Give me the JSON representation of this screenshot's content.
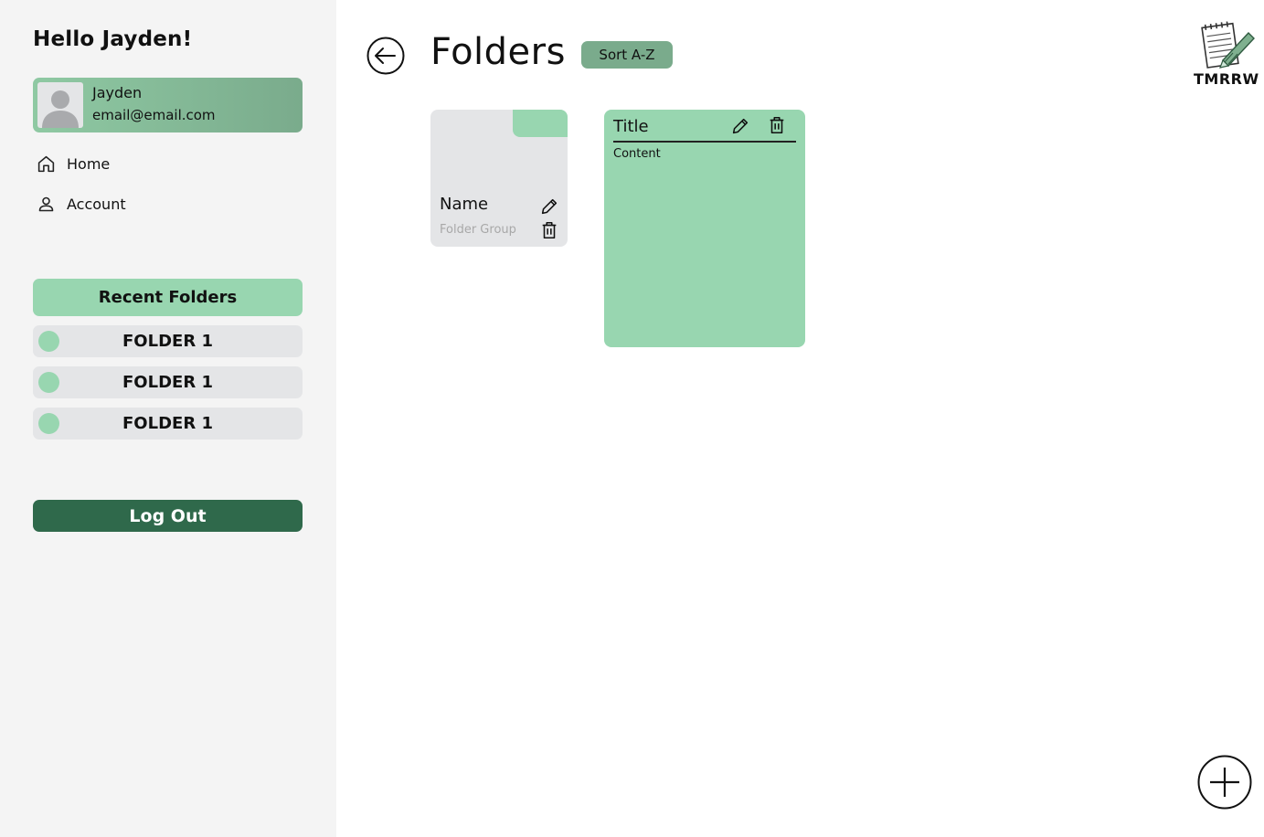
{
  "sidebar": {
    "greeting": "Hello Jayden!",
    "user": {
      "name": "Jayden",
      "email": "email@email.com"
    },
    "nav": [
      {
        "label": "Home",
        "icon": "home-icon"
      },
      {
        "label": "Account",
        "icon": "user-icon"
      }
    ],
    "recent_header": "Recent Folders",
    "recent_folders": [
      {
        "label": "FOLDER 1"
      },
      {
        "label": "FOLDER 1"
      },
      {
        "label": "FOLDER 1"
      }
    ],
    "logout_label": "Log Out"
  },
  "header": {
    "title": "Folders",
    "sort_label": "Sort A-Z",
    "logo_text": "TMRRW"
  },
  "folder_card": {
    "name": "Name",
    "group": "Folder Group"
  },
  "note_card": {
    "title": "Title",
    "content": "Content"
  },
  "colors": {
    "sidebar_bg": "#f4f4f4",
    "accent_light": "#98d6b0",
    "accent_mid": "#7aab8c",
    "accent_dark": "#2f694b",
    "card_gray": "#e4e5e7"
  }
}
